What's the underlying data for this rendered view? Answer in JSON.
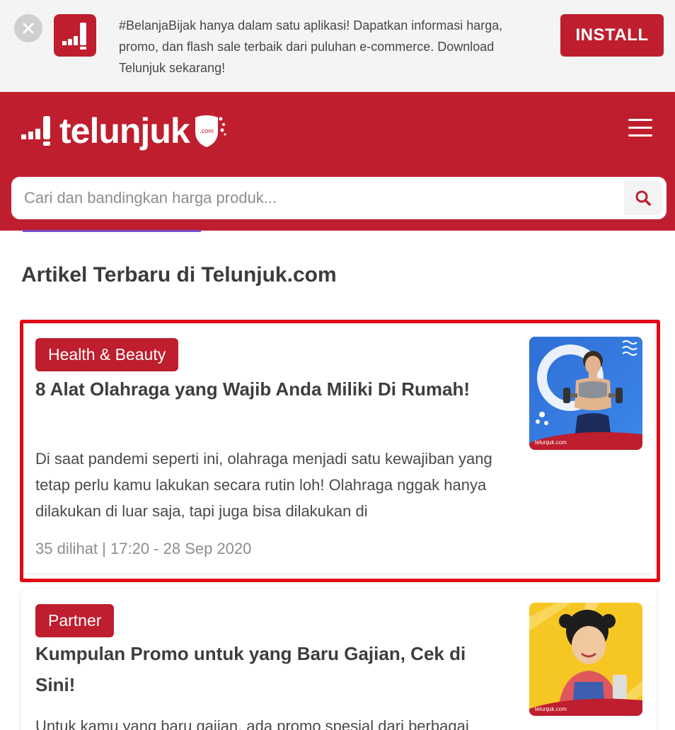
{
  "banner": {
    "text": "#BelanjaBijak hanya dalam satu aplikasi! Dapatkan informasi harga, promo, dan flash sale terbaik dari puluhan e-commerce. Download Telunjuk sekarang!",
    "install_label": "INSTALL"
  },
  "header": {
    "logo_text": "telunjuk",
    "logo_domain": ".com"
  },
  "search": {
    "placeholder": "Cari dan bandingkan harga produk..."
  },
  "section": {
    "title": "Artikel Terbaru di Telunjuk.com"
  },
  "articles": [
    {
      "category": "Health & Beauty",
      "title": "8 Alat Olahraga yang Wajib Anda Miliki Di Rumah!",
      "excerpt": "Di saat pandemi seperti ini, olahraga menjadi satu kewajiban yang tetap perlu kamu lakukan secara rutin loh! Olahraga nggak hanya dilakukan di luar saja, tapi juga bisa dilakukan di",
      "meta": "35 dilihat | 17:20 - 28 Sep 2020",
      "thumb_watermark": "telunjuk.com"
    },
    {
      "category": "Partner",
      "title": "Kumpulan Promo untuk yang Baru Gajian, Cek di Sini!",
      "excerpt": "Untuk kamu yang baru gajian, ada promo spesial dari berbagai",
      "thumb_watermark": "telunjuk.com"
    }
  ],
  "colors": {
    "brand_red": "#be1e2d",
    "highlight": "#e30613"
  }
}
